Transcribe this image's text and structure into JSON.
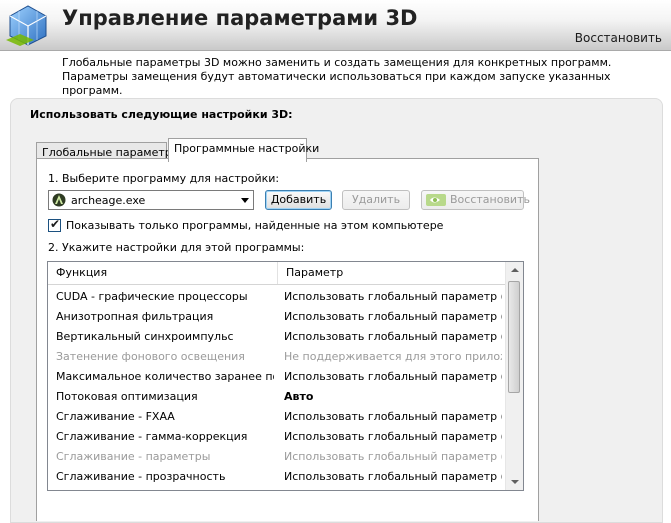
{
  "header": {
    "title": "Управление параметрами 3D",
    "restore_label": "Восстановить"
  },
  "description": "Глобальные параметры 3D можно заменить и создать замещения для конкретных программ. Параметры замещения будут автоматически использоваться при каждом запуске указанных программ.",
  "panel": {
    "title": "Использовать следующие настройки 3D:",
    "tabs": [
      {
        "label": "Глобальные параметры",
        "active": false
      },
      {
        "label": "Программные настройки",
        "active": true
      }
    ]
  },
  "program": {
    "step1_label": "1. Выберите программу для настройки:",
    "selected": "archeage.exe",
    "add_label": "Добавить",
    "remove_label": "Удалить",
    "restore_label": "Восстановить",
    "checkbox_label": "Показывать только программы, найденные на этом компьютере",
    "checkbox_checked": true,
    "step2_label": "2. Укажите настройки для этой программы:"
  },
  "table": {
    "columns": [
      "Функция",
      "Параметр"
    ],
    "rows": [
      {
        "function": "CUDA - графические процессоры",
        "param": "Использовать глобальный параметр (Все)",
        "dim": false
      },
      {
        "function": "Анизотропная фильтрация",
        "param": "Использовать глобальный параметр (У...",
        "dim": false
      },
      {
        "function": "Вертикальный синхроимпульс",
        "param": "Использовать глобальный параметр (И...",
        "dim": false
      },
      {
        "function": "Затенение фонового освещения",
        "param": "Не поддерживается для этого приложе...",
        "dim": true
      },
      {
        "function": "Максимальное количество заранее под...",
        "param": "Использовать глобальный параметр (И...",
        "dim": false
      },
      {
        "function": "Потоковая оптимизация",
        "param": "Авто",
        "dim": false,
        "bold": true
      },
      {
        "function": "Сглаживание - FXAA",
        "param": "Использовать глобальный параметр (В...",
        "dim": false
      },
      {
        "function": "Сглаживание - гамма-коррекция",
        "param": "Использовать глобальный параметр (Вкл)",
        "dim": false
      },
      {
        "function": "Сглаживание - параметры",
        "param": "Использовать глобальный параметр (У...",
        "dim": true
      },
      {
        "function": "Сглаживание - прозрачность",
        "param": "Использовать глобальный параметр (В...",
        "dim": false
      }
    ]
  },
  "colors": {
    "accent_green": "#76b900",
    "dim_text": "#9a9a9a"
  }
}
